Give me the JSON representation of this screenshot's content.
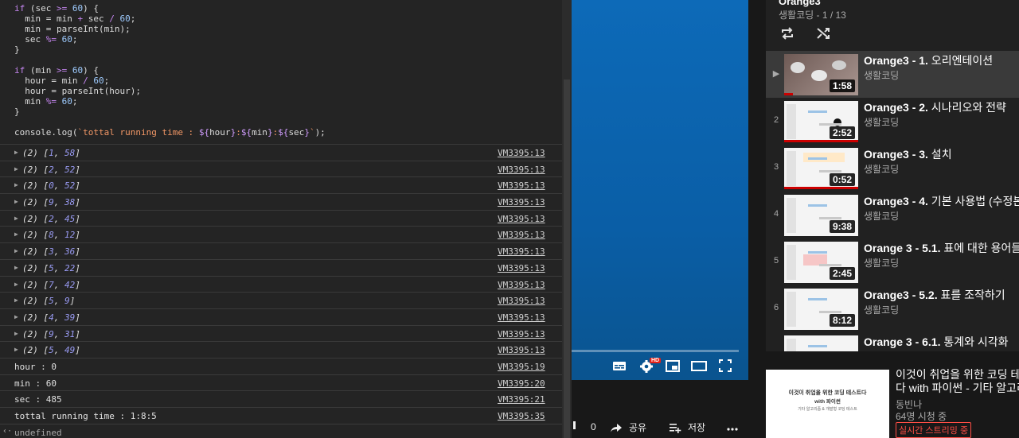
{
  "console": {
    "code_lines": [
      [
        {
          "t": "if",
          "c": "kw"
        },
        {
          "t": " (sec "
        },
        {
          "t": ">=",
          "c": "kw"
        },
        {
          "t": " "
        },
        {
          "t": "60",
          "c": "num"
        },
        {
          "t": ") {"
        }
      ],
      [
        {
          "t": "  min = min "
        },
        {
          "t": "+",
          "c": "kw"
        },
        {
          "t": " sec "
        },
        {
          "t": "/",
          "c": "kw"
        },
        {
          "t": " "
        },
        {
          "t": "60",
          "c": "num"
        },
        {
          "t": ";"
        }
      ],
      [
        {
          "t": "  min = parseInt(min);"
        }
      ],
      [
        {
          "t": "  sec "
        },
        {
          "t": "%=",
          "c": "kw"
        },
        {
          "t": " "
        },
        {
          "t": "60",
          "c": "num"
        },
        {
          "t": ";"
        }
      ],
      [
        {
          "t": "}"
        }
      ],
      [
        {
          "t": ""
        }
      ],
      [
        {
          "t": "if",
          "c": "kw"
        },
        {
          "t": " (min "
        },
        {
          "t": ">=",
          "c": "kw"
        },
        {
          "t": " "
        },
        {
          "t": "60",
          "c": "num"
        },
        {
          "t": ") {"
        }
      ],
      [
        {
          "t": "  hour = min "
        },
        {
          "t": "/",
          "c": "kw"
        },
        {
          "t": " "
        },
        {
          "t": "60",
          "c": "num"
        },
        {
          "t": ";"
        }
      ],
      [
        {
          "t": "  hour = parseInt(hour);"
        }
      ],
      [
        {
          "t": "  min "
        },
        {
          "t": "%=",
          "c": "kw"
        },
        {
          "t": " "
        },
        {
          "t": "60",
          "c": "num"
        },
        {
          "t": ";"
        }
      ],
      [
        {
          "t": "}"
        }
      ],
      [
        {
          "t": ""
        }
      ],
      [
        {
          "t": "console.log("
        },
        {
          "t": "`tottal running time : ",
          "c": "str"
        },
        {
          "t": "${",
          "c": "tpl"
        },
        {
          "t": "hour"
        },
        {
          "t": "}",
          "c": "tpl"
        },
        {
          "t": ":",
          "c": "str"
        },
        {
          "t": "${",
          "c": "tpl"
        },
        {
          "t": "min"
        },
        {
          "t": "}",
          "c": "tpl"
        },
        {
          "t": ":",
          "c": "str"
        },
        {
          "t": "${",
          "c": "tpl"
        },
        {
          "t": "sec"
        },
        {
          "t": "}",
          "c": "tpl"
        },
        {
          "t": "`",
          "c": "str"
        },
        {
          "t": ");"
        }
      ]
    ],
    "array_logs": [
      {
        "len": "(2)",
        "a": "1",
        "b": "58",
        "src": "VM3395:13"
      },
      {
        "len": "(2)",
        "a": "2",
        "b": "52",
        "src": "VM3395:13"
      },
      {
        "len": "(2)",
        "a": "0",
        "b": "52",
        "src": "VM3395:13"
      },
      {
        "len": "(2)",
        "a": "9",
        "b": "38",
        "src": "VM3395:13"
      },
      {
        "len": "(2)",
        "a": "2",
        "b": "45",
        "src": "VM3395:13"
      },
      {
        "len": "(2)",
        "a": "8",
        "b": "12",
        "src": "VM3395:13"
      },
      {
        "len": "(2)",
        "a": "3",
        "b": "36",
        "src": "VM3395:13"
      },
      {
        "len": "(2)",
        "a": "5",
        "b": "22",
        "src": "VM3395:13"
      },
      {
        "len": "(2)",
        "a": "7",
        "b": "42",
        "src": "VM3395:13"
      },
      {
        "len": "(2)",
        "a": "5",
        "b": "9",
        "src": "VM3395:13"
      },
      {
        "len": "(2)",
        "a": "4",
        "b": "39",
        "src": "VM3395:13"
      },
      {
        "len": "(2)",
        "a": "9",
        "b": "31",
        "src": "VM3395:13"
      },
      {
        "len": "(2)",
        "a": "5",
        "b": "49",
        "src": "VM3395:13"
      }
    ],
    "text_logs": [
      {
        "text": "hour : 0",
        "src": "VM3395:19"
      },
      {
        "text": "min : 60",
        "src": "VM3395:20"
      },
      {
        "text": "sec : 485",
        "src": "VM3395:21"
      },
      {
        "text": "tottal running time : 1:8:5",
        "src": "VM3395:35"
      }
    ],
    "result": "undefined",
    "result_icon": "chevron-left-icon"
  },
  "video": {
    "progress_fraction": 0.0,
    "controls": [
      "subtitles-icon",
      "settings-icon",
      "miniplayer-icon",
      "theater-icon",
      "fullscreen-icon"
    ],
    "hd_badge": "HD"
  },
  "actions": {
    "dislike_count": "0",
    "share_label": "공유",
    "save_label": "저장",
    "more_icon": "more-icon"
  },
  "playlist": {
    "title": "Orange3",
    "subtitle": "생활코딩 - 1 / 13",
    "items": [
      {
        "index": "▶",
        "prefix": "Orange3 - 1.",
        "name": " 오리엔테이션",
        "channel": "생활코딩",
        "duration": "1:58",
        "active": true,
        "watched": 0.12
      },
      {
        "index": "2",
        "prefix": "Orange3 - 2.",
        "name": " 시나리오와 전략",
        "channel": "생활코딩",
        "duration": "2:52",
        "active": false,
        "watched": 1.0
      },
      {
        "index": "3",
        "prefix": "Orange3 - 3.",
        "name": " 설치",
        "channel": "생활코딩",
        "duration": "0:52",
        "active": false,
        "watched": 1.0
      },
      {
        "index": "4",
        "prefix": "Orange3 - 4.",
        "name": " 기본 사용법 (수정본)",
        "channel": "생활코딩",
        "duration": "9:38",
        "active": false,
        "watched": 0.0
      },
      {
        "index": "5",
        "prefix": "Orange 3 - 5.1.",
        "name": " 표에 대한 용어들",
        "channel": "생활코딩",
        "duration": "2:45",
        "active": false,
        "watched": 0.0
      },
      {
        "index": "6",
        "prefix": "Orange3 - 5.2.",
        "name": " 표를 조작하기",
        "channel": "생활코딩",
        "duration": "8:12",
        "active": false,
        "watched": 0.0
      },
      {
        "index": "",
        "prefix": "Orange 3 - 6.1.",
        "name": " 통계와 시각화",
        "channel": "",
        "duration": "",
        "active": false,
        "watched": 0.0
      }
    ]
  },
  "recommendation": {
    "thumb_line1": "이것이 취업을 위한 코딩 테스트다",
    "thumb_line2": "with 파이썬",
    "thumb_line3": "기타 알고리즘 & 개발형 코딩 테스트",
    "title_line1": "이것이 취업을 위한 코딩 테",
    "title_line2": "다 with 파이썬 - 기타 알고리",
    "channel": "동빈나",
    "views": "64명 시청 중",
    "live_badge": "실시간 스트리밍 중"
  }
}
